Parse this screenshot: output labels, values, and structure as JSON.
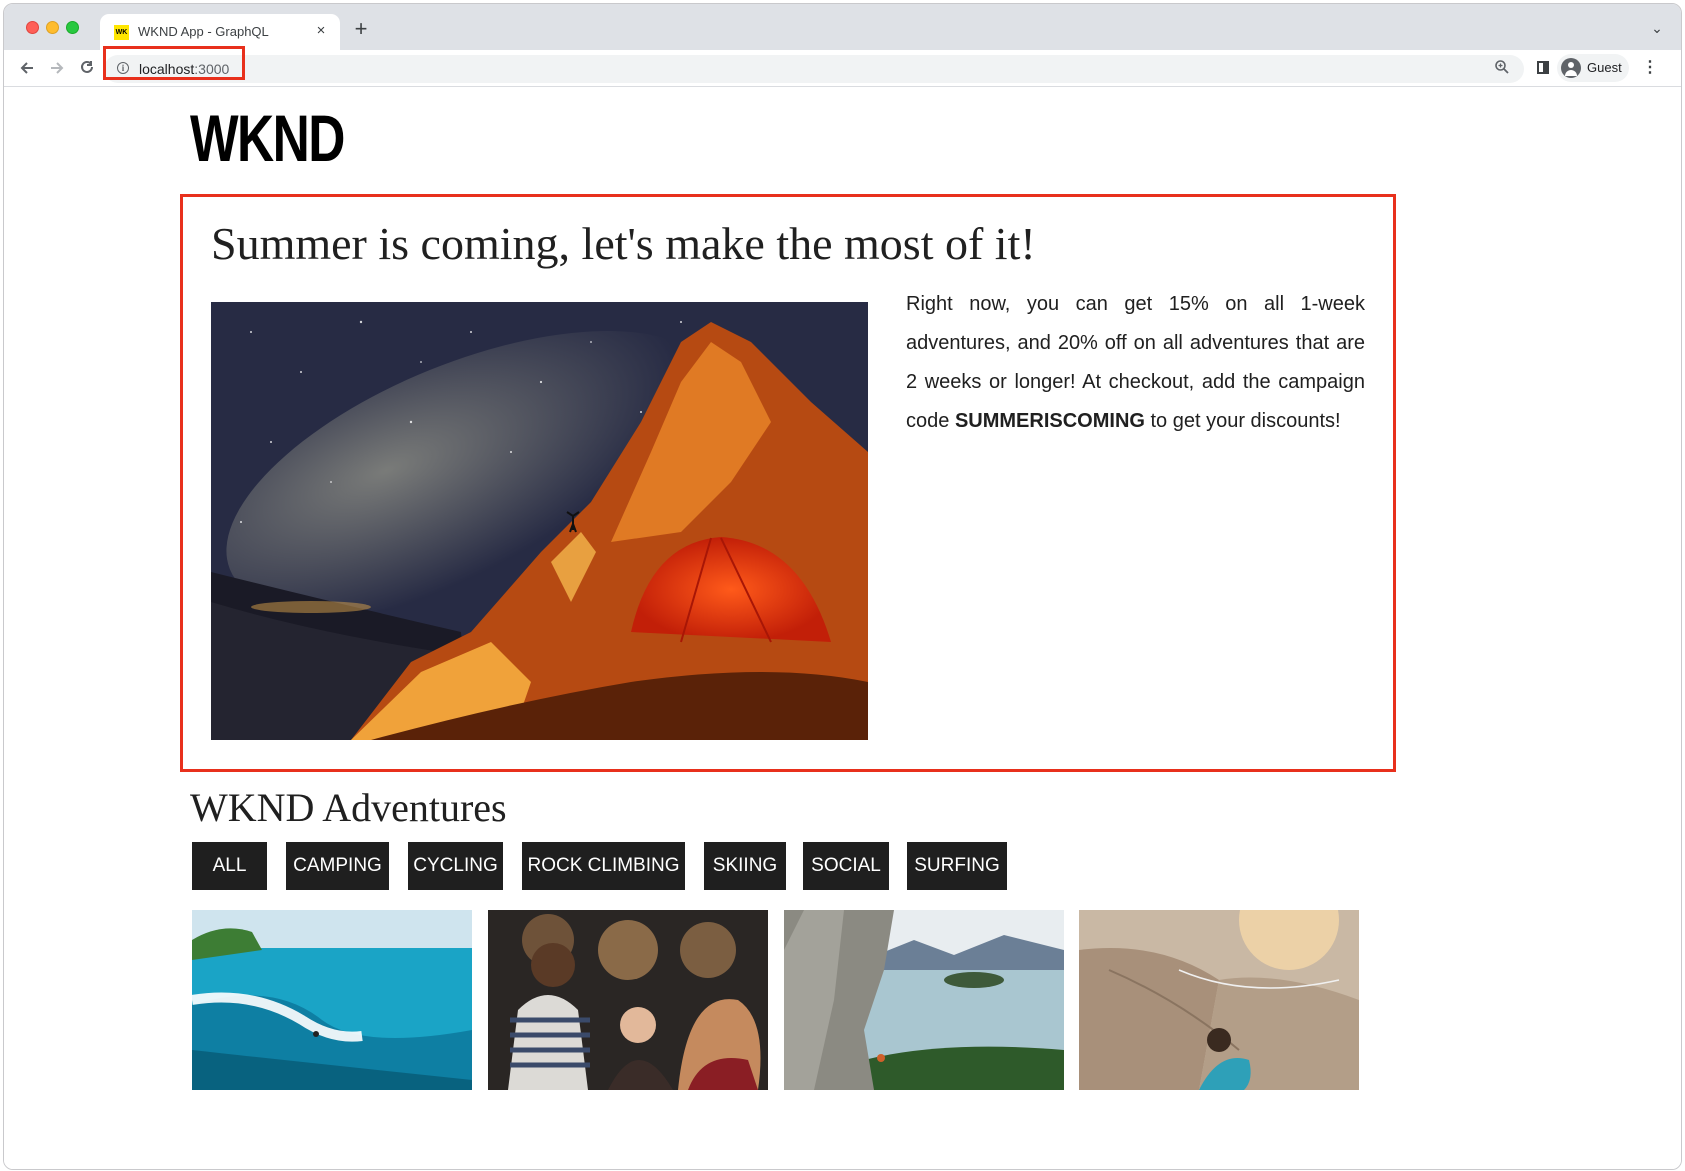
{
  "browser": {
    "tab_title": "WKND App - GraphQL",
    "tab_favicon_text": "WK",
    "tab_close_glyph": "×",
    "new_tab_glyph": "+",
    "tab_menu_glyph": "⌄",
    "url_host": "localhost",
    "url_port": ":3000",
    "profile_label": "Guest",
    "icons": [
      "back-arrow-icon",
      "forward-arrow-icon",
      "reload-icon",
      "site-info-icon",
      "zoom-icon",
      "side-panel-icon",
      "avatar-icon",
      "kebab-menu-icon"
    ]
  },
  "page": {
    "logo": "WKND",
    "promo": {
      "title": "Summer is coming, let's make the most of it!",
      "text_before": "Right now, you can get 15% on all 1-week adventures, and 20% off on all adventures that are 2 weeks or longer! At checkout, add the campaign code ",
      "code": "SUMMERISCOMING",
      "text_after": " to get your discounts!",
      "image_alt": "tent-under-milky-way"
    },
    "adventures": {
      "title": "WKND Adventures",
      "filters": [
        "ALL",
        "CAMPING",
        "CYCLING",
        "ROCK CLIMBING",
        "SKIING",
        "SOCIAL",
        "SURFING"
      ],
      "cards": [
        "surfing-image",
        "social-bar-image",
        "lake-cliff-image",
        "rock-climbing-image"
      ]
    }
  },
  "colors": {
    "highlight": "#e8301c",
    "filter_bg": "#1f1f1f",
    "favicon": "#ffe600"
  }
}
